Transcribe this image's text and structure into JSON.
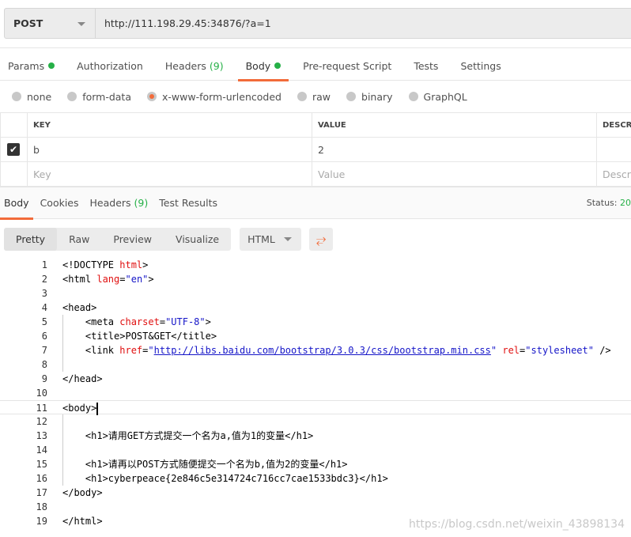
{
  "request": {
    "method": "POST",
    "url": "http://111.198.29.45:34876/?a=1"
  },
  "tabs": [
    {
      "label": "Params",
      "dot": true
    },
    {
      "label": "Authorization"
    },
    {
      "label": "Headers",
      "count": "(9)"
    },
    {
      "label": "Body",
      "dot": true,
      "active": true
    },
    {
      "label": "Pre-request Script"
    },
    {
      "label": "Tests"
    },
    {
      "label": "Settings"
    }
  ],
  "body_types": [
    {
      "label": "none"
    },
    {
      "label": "form-data"
    },
    {
      "label": "x-www-form-urlencoded",
      "selected": true
    },
    {
      "label": "raw"
    },
    {
      "label": "binary"
    },
    {
      "label": "GraphQL"
    }
  ],
  "table": {
    "headers": [
      "KEY",
      "VALUE",
      "DESCRIP"
    ],
    "rows": [
      {
        "checked": true,
        "key": "b",
        "value": "2",
        "description": ""
      }
    ],
    "placeholder": {
      "key": "Key",
      "value": "Value",
      "description": "Descrip"
    }
  },
  "response": {
    "tabs": [
      {
        "label": "Body",
        "active": true
      },
      {
        "label": "Cookies"
      },
      {
        "label": "Headers",
        "count": "(9)"
      },
      {
        "label": "Test Results"
      }
    ],
    "status_label": "Status:",
    "status_value": "20"
  },
  "viewer": {
    "modes": [
      "Pretty",
      "Raw",
      "Preview",
      "Visualize"
    ],
    "selected_mode": "Pretty",
    "format": "HTML",
    "wrap_icon": "wrap-lines-icon"
  },
  "code": [
    [
      [
        "tag",
        "<!DOCTYPE "
      ],
      [
        "attr",
        "html"
      ],
      [
        "tag",
        ">"
      ]
    ],
    [
      [
        "tag",
        "<html "
      ],
      [
        "attr",
        "lang"
      ],
      [
        "tag",
        "="
      ],
      [
        "str",
        "\"en\""
      ],
      [
        "tag",
        ">"
      ]
    ],
    [],
    [
      [
        "tag",
        "<head>"
      ]
    ],
    [
      [
        "tag",
        "    <meta "
      ],
      [
        "attr",
        "charset"
      ],
      [
        "tag",
        "="
      ],
      [
        "str",
        "\"UTF-8\""
      ],
      [
        "tag",
        ">"
      ]
    ],
    [
      [
        "tag",
        "    <title>POST&GET</title>"
      ]
    ],
    [
      [
        "tag",
        "    <link "
      ],
      [
        "attr",
        "href"
      ],
      [
        "tag",
        "="
      ],
      [
        "str",
        "\""
      ],
      [
        "link",
        "http://libs.baidu.com/bootstrap/3.0.3/css/bootstrap.min.css"
      ],
      [
        "str",
        "\""
      ],
      [
        "tag",
        " "
      ],
      [
        "attr",
        "rel"
      ],
      [
        "tag",
        "="
      ],
      [
        "str",
        "\"stylesheet\""
      ],
      [
        "tag",
        " />"
      ]
    ],
    [],
    [
      [
        "tag",
        "</head>"
      ]
    ],
    [],
    [
      [
        "tag",
        "<body>"
      ]
    ],
    [],
    [
      [
        "tag",
        "    <h1>请用GET方式提交一个名为a,值为1的变量</h1>"
      ]
    ],
    [],
    [
      [
        "tag",
        "    <h1>请再以POST方式随便提交一个名为b,值为2的变量</h1>"
      ]
    ],
    [
      [
        "tag",
        "    <h1>cyberpeace{2e846c5e314724c716cc7cae1533bdc3}</h1>"
      ]
    ],
    [
      [
        "tag",
        "</body>"
      ]
    ],
    [],
    [
      [
        "tag",
        "</html>"
      ]
    ]
  ],
  "watermark": "https://blog.csdn.net/weixin_43898134"
}
